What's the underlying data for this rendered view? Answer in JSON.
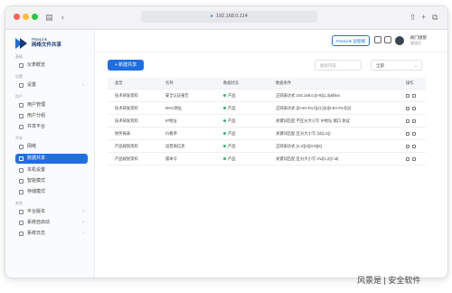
{
  "browser": {
    "url": "192.168.0.114"
  },
  "app": {
    "logo_small": "PiseLink",
    "logo_main": "网络文件共享"
  },
  "sidebar": {
    "sections": [
      {
        "label": "基础"
      },
      {
        "label": "设置"
      },
      {
        "label": "用户"
      },
      {
        "label": "共享"
      },
      {
        "label": "其他"
      }
    ],
    "items": [
      {
        "label": "仪表概览",
        "icon": "dashboard-icon"
      },
      {
        "label": "设置",
        "icon": "settings-icon",
        "has_chevron": true
      },
      {
        "label": "用户管理",
        "icon": "user-icon"
      },
      {
        "label": "用户分组",
        "icon": "users-icon"
      },
      {
        "label": "共享平台",
        "icon": "share-icon"
      },
      {
        "label": "网络",
        "icon": "network-icon"
      },
      {
        "label": "数据共享",
        "icon": "data-icon",
        "active": true
      },
      {
        "label": "本机设置",
        "icon": "device-icon"
      },
      {
        "label": "智能模式",
        "icon": "smart-icon"
      },
      {
        "label": "存储模式",
        "icon": "storage-icon"
      },
      {
        "label": "平台版本",
        "icon": "version-icon",
        "has_chevron": true
      },
      {
        "label": "系统自启动",
        "icon": "startup-icon",
        "has_chevron": true
      },
      {
        "label": "系统日志",
        "icon": "log-icon",
        "has_chevron": true
      }
    ]
  },
  "header": {
    "pinlink_button": "PiseLink 远程端",
    "user_name": "刷门组管",
    "user_role": "管理员"
  },
  "main": {
    "add_button": "+ 新建共享",
    "search_placeholder": "搜索内容",
    "filter_value": "全部",
    "columns": [
      "类型",
      "名称",
      "数据状态",
      "数据条件",
      "操作"
    ],
    "rows": [
      {
        "type": "技术研发资料",
        "name": "安全认证报告",
        "status": "产品",
        "condition": "正则表达式 192.168.0.[0-9]{1,3}&files"
      },
      {
        "type": "技术研发资料",
        "name": "MAC地址",
        "status": "产品",
        "condition": "正则表达式 ([0-9A-Fa-f]{2}:){5}[0-9A-Fa-f]{2}"
      },
      {
        "type": "技术研发资料",
        "name": "IP地址",
        "status": "产品",
        "condition": "关键词匹配 不区分大小写 IP地址 端口 协议"
      },
      {
        "type": "财务报表",
        "name": "价格单",
        "status": "产品",
        "condition": "关键词匹配 区分大小写 {\\d{1,6}}"
      },
      {
        "type": "产品规划资料",
        "name": "运营商信息",
        "status": "产品",
        "condition": "正则表达式 [A-Z]{2}[0-9]{6}"
      },
      {
        "type": "产品规划资料",
        "name": "版本号",
        "status": "产品",
        "condition": "关键词匹配 区分大小写 V\\d{1,2}(\\.\\d)"
      }
    ]
  },
  "watermark": "风景是 | 安全软件",
  "colors": {
    "accent": "#1f6fe0",
    "status_ok": "#2fb36b"
  }
}
